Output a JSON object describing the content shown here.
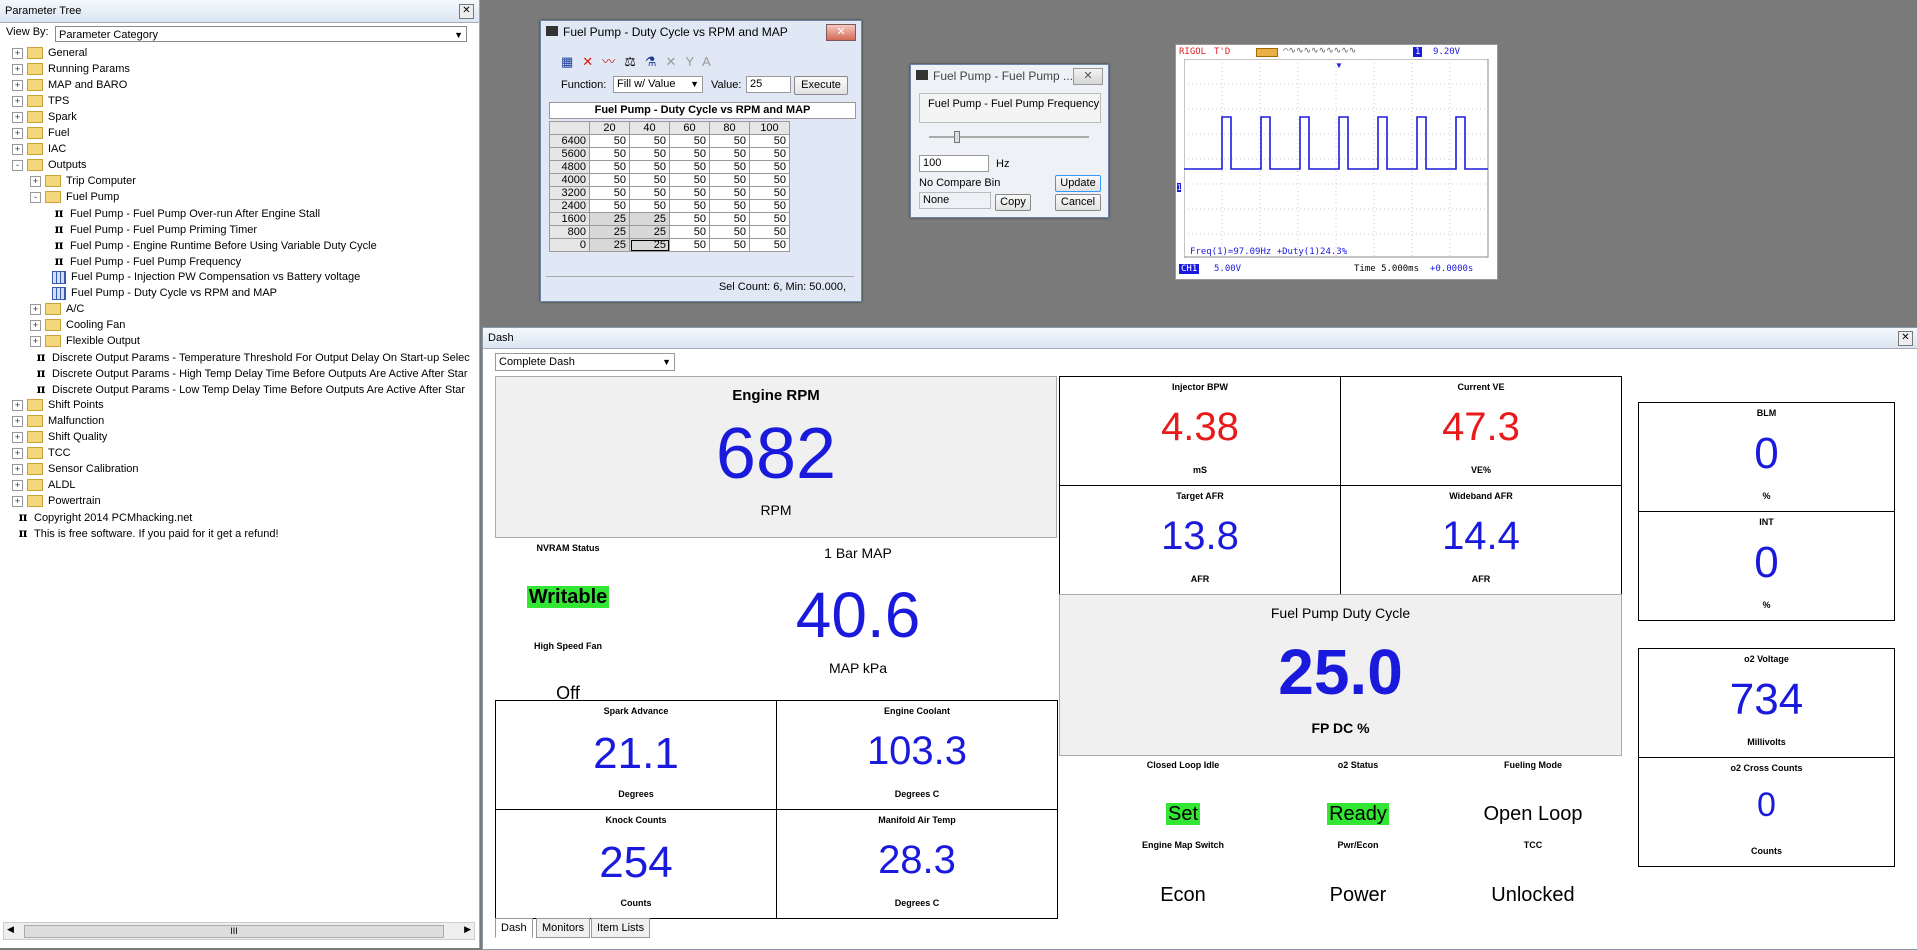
{
  "tree": {
    "title": "Parameter Tree",
    "viewby_label": "View By:",
    "viewby_value": "Parameter Category",
    "items": [
      {
        "label": "General"
      },
      {
        "label": "Running Params"
      },
      {
        "label": "MAP and BARO"
      },
      {
        "label": "TPS"
      },
      {
        "label": "Spark"
      },
      {
        "label": "Fuel"
      },
      {
        "label": "IAC"
      },
      {
        "label": "Outputs"
      },
      {
        "label": "Trip Computer"
      },
      {
        "label": "Fuel Pump"
      },
      {
        "label": "Fuel Pump - Fuel Pump Over-run After Engine Stall"
      },
      {
        "label": "Fuel Pump - Fuel Pump Priming Timer"
      },
      {
        "label": "Fuel Pump - Engine Runtime Before Using Variable Duty Cycle"
      },
      {
        "label": "Fuel Pump - Fuel Pump Frequency"
      },
      {
        "label": "Fuel Pump - Injection PW Compensation vs Battery voltage"
      },
      {
        "label": "Fuel Pump - Duty Cycle vs RPM and MAP"
      },
      {
        "label": "A/C"
      },
      {
        "label": "Cooling Fan"
      },
      {
        "label": "Flexible Output"
      },
      {
        "label": "Discrete Output Params - Temperature Threshold For Output Delay On Start-up Selec"
      },
      {
        "label": "Discrete Output Params - High Temp Delay Time Before Outputs Are Active After Star"
      },
      {
        "label": "Discrete Output Params - Low Temp Delay Time Before Outputs Are Active After Star"
      },
      {
        "label": "Shift Points"
      },
      {
        "label": "Malfunction"
      },
      {
        "label": "Shift Quality"
      },
      {
        "label": "TCC"
      },
      {
        "label": "Sensor Calibration"
      },
      {
        "label": "ALDL"
      },
      {
        "label": "Powertrain"
      },
      {
        "label": "Copyright 2014 PCMhacking.net"
      },
      {
        "label": "This is free software. If you paid for it get a refund!"
      }
    ],
    "scroll_grip": "III"
  },
  "map_window": {
    "title": "Fuel Pump - Duty Cycle vs RPM and MAP",
    "function_label": "Function:",
    "function_value": "Fill w/ Value",
    "value_label": "Value:",
    "value": "25",
    "execute": "Execute",
    "table_title": "Fuel Pump - Duty Cycle vs RPM and MAP",
    "cols": [
      "20",
      "40",
      "60",
      "80",
      "100"
    ],
    "rows": [
      {
        "rpm": "6400",
        "v": [
          "50",
          "50",
          "50",
          "50",
          "50"
        ]
      },
      {
        "rpm": "5600",
        "v": [
          "50",
          "50",
          "50",
          "50",
          "50"
        ]
      },
      {
        "rpm": "4800",
        "v": [
          "50",
          "50",
          "50",
          "50",
          "50"
        ]
      },
      {
        "rpm": "4000",
        "v": [
          "50",
          "50",
          "50",
          "50",
          "50"
        ]
      },
      {
        "rpm": "3200",
        "v": [
          "50",
          "50",
          "50",
          "50",
          "50"
        ]
      },
      {
        "rpm": "2400",
        "v": [
          "50",
          "50",
          "50",
          "50",
          "50"
        ]
      },
      {
        "rpm": "1600",
        "v": [
          "25",
          "25",
          "50",
          "50",
          "50"
        ]
      },
      {
        "rpm": "800",
        "v": [
          "25",
          "25",
          "50",
          "50",
          "50"
        ]
      },
      {
        "rpm": "0",
        "v": [
          "25",
          "25",
          "50",
          "50",
          "50"
        ]
      }
    ],
    "status": "Sel Count: 6, Min: 50.000,"
  },
  "freq_window": {
    "title": "Fuel Pump - Fuel Pump ...",
    "label": "Fuel Pump - Fuel Pump Frequency",
    "value": "100",
    "unit": "Hz",
    "update": "Update",
    "compare": "No Compare Bin",
    "none": "None",
    "copy": "Copy",
    "cancel": "Cancel"
  },
  "scope": {
    "brand": "RIGOL",
    "mode": "T'D",
    "trig": "1",
    "trig_level": "9.20V",
    "readout": "Freq(1)=97.09Hz   +Duty(1)24.3%",
    "ch1": "CH1",
    "ch1_scale": "5.00V",
    "time": "Time 5.000ms",
    "offset": "+0.0000s"
  },
  "dash": {
    "title": "Dash",
    "selector": "Complete Dash",
    "rpm": {
      "title": "Engine RPM",
      "value": "682",
      "unit": "RPM"
    },
    "nvram_label": "NVRAM Status",
    "nvram_value": "Writable",
    "fan_label": "High Speed Fan",
    "fan_value": "Off",
    "map": {
      "title": "1 Bar MAP",
      "value": "40.6",
      "unit": "MAP kPa"
    },
    "spark": {
      "title": "Spark Advance",
      "value": "21.1",
      "unit": "Degrees"
    },
    "coolant": {
      "title": "Engine Coolant",
      "value": "103.3",
      "unit": "Degrees C"
    },
    "knock": {
      "title": "Knock Counts",
      "value": "254",
      "unit": "Counts"
    },
    "mat": {
      "title": "Manifold Air Temp",
      "value": "28.3",
      "unit": "Degrees C"
    },
    "inj": {
      "title": "Injector BPW",
      "value": "4.38",
      "unit": "mS"
    },
    "ve": {
      "title": "Current VE",
      "value": "47.3",
      "unit": "VE%"
    },
    "tafr": {
      "title": "Target AFR",
      "value": "13.8",
      "unit": "AFR"
    },
    "wafr": {
      "title": "Wideband AFR",
      "value": "14.4",
      "unit": "AFR"
    },
    "fpdc": {
      "title": "Fuel Pump Duty Cycle",
      "value": "25.0",
      "unit": "FP DC %"
    },
    "cli_label": "Closed Loop Idle",
    "cli_value": "Set",
    "o2s_label": "o2 Status",
    "o2s_value": "Ready",
    "fm_label": "Fueling Mode",
    "fm_value": "Open Loop",
    "ems_label": "Engine Map Switch",
    "ems_value": "Econ",
    "pe_label": "Pwr/Econ",
    "pe_value": "Power",
    "tcc_label": "TCC",
    "tcc_value": "Unlocked",
    "blm": {
      "title": "BLM",
      "value": "0",
      "unit": "%"
    },
    "int": {
      "title": "INT",
      "value": "0",
      "unit": "%"
    },
    "o2v": {
      "title": "o2 Voltage",
      "value": "734",
      "unit": "Millivolts"
    },
    "o2c": {
      "title": "o2 Cross Counts",
      "value": "0",
      "unit": "Counts"
    },
    "tabs": [
      "Dash",
      "Monitors",
      "Item Lists"
    ]
  }
}
